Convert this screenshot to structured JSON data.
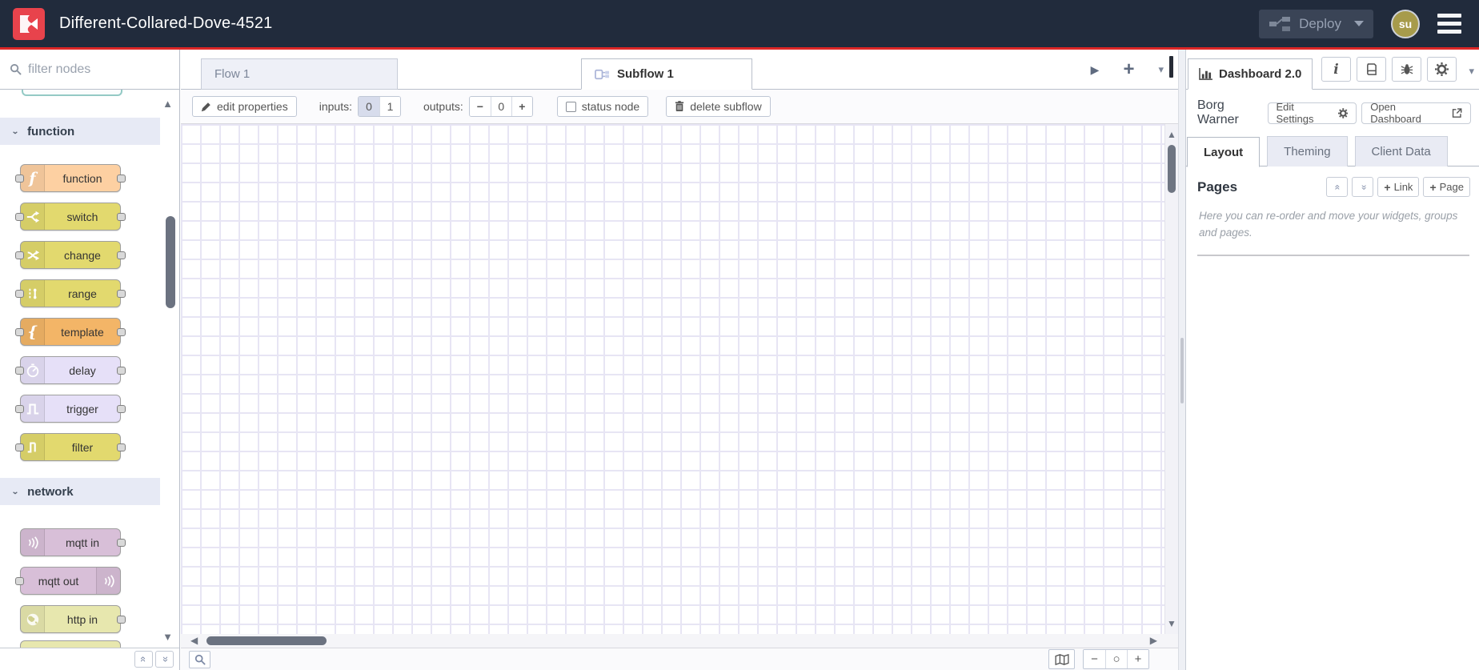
{
  "header": {
    "title": "Different-Collared-Dove-4521",
    "deploy_label": "Deploy",
    "avatar_initials": "su"
  },
  "colors": {
    "header_bg": "#212b3c",
    "header_accent_red": "#dd2626",
    "logo_red": "#e8434c",
    "avatar_olive": "#a79b4b",
    "grid_line": "#e7e5f4",
    "section_header_bg": "#e7eaf5"
  },
  "palette": {
    "search_placeholder": "filter nodes",
    "sections": [
      {
        "label": "function",
        "nodes": [
          {
            "label": "function",
            "color": "#fdd0a2"
          },
          {
            "label": "switch",
            "color": "#e2d96e"
          },
          {
            "label": "change",
            "color": "#e2d96e"
          },
          {
            "label": "range",
            "color": "#e2d96e"
          },
          {
            "label": "template",
            "color": "#f3b567"
          },
          {
            "label": "delay",
            "color": "#e6e0f8"
          },
          {
            "label": "trigger",
            "color": "#e6e0f8"
          },
          {
            "label": "filter",
            "color": "#e2d96e"
          }
        ]
      },
      {
        "label": "network",
        "nodes": [
          {
            "label": "mqtt in",
            "color": "#d8bfd8"
          },
          {
            "label": "mqtt out",
            "color": "#d8bfd8"
          },
          {
            "label": "http in",
            "color": "#e7e7ae"
          },
          {
            "label": "",
            "color": "#e7e7ae"
          }
        ]
      }
    ]
  },
  "workspace": {
    "tabs": [
      {
        "label": "Flow 1"
      },
      {
        "label": "Subflow 1"
      }
    ],
    "subflow_toolbar": {
      "edit_properties": "edit properties",
      "inputs_label": "inputs:",
      "inputs_options": [
        "0",
        "1"
      ],
      "inputs_selected": "0",
      "outputs_label": "outputs:",
      "outputs_value": "0",
      "status_node": "status node",
      "delete_subflow": "delete subflow"
    }
  },
  "sidebar": {
    "tab_label": "Dashboard 2.0",
    "instance_name": "Borg Warner",
    "edit_settings_label": "Edit Settings",
    "open_dashboard_label": "Open Dashboard",
    "tabs": [
      "Layout",
      "Theming",
      "Client Data"
    ],
    "active_tab": "Layout",
    "pages_title": "Pages",
    "link_button_label": "Link",
    "page_button_label": "Page",
    "help_text": "Here you can re-order and move your widgets, groups and pages."
  },
  "glyphs": {
    "triangle_up": "▲",
    "triangle_down": "▼",
    "triangle_left": "◀",
    "triangle_right": "▶",
    "caret_down": "▾",
    "plus": "+",
    "minus": "−",
    "circle": "○",
    "double_chevron": "«",
    "chevron_down": "⌄",
    "info": "i"
  }
}
